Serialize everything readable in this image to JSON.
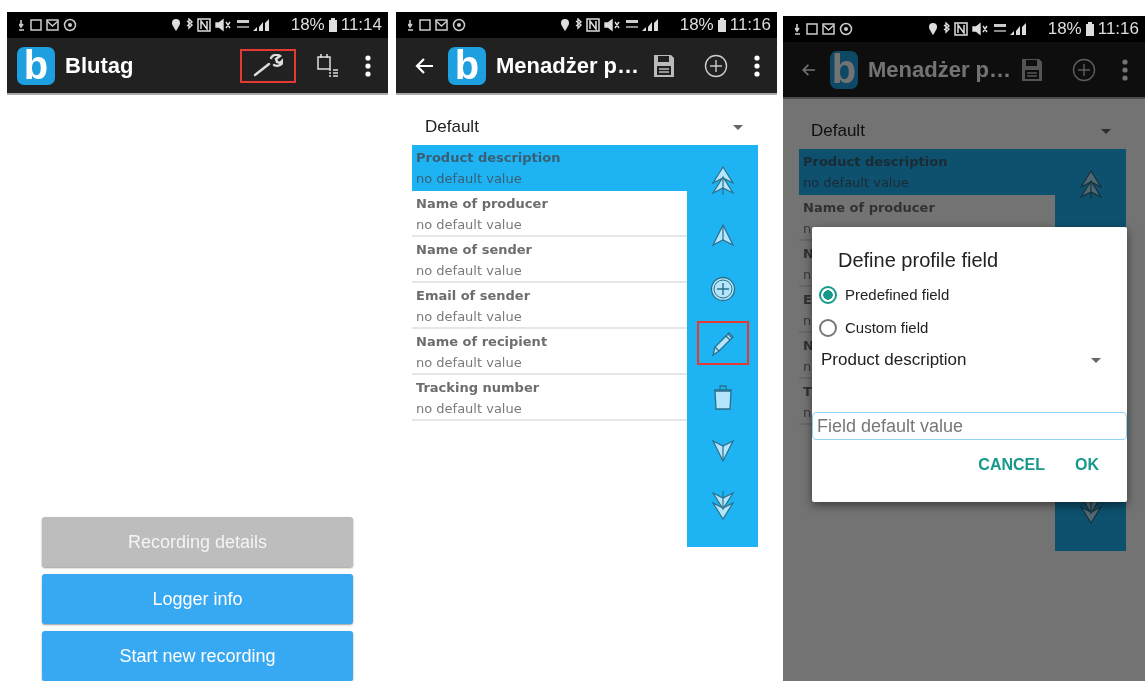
{
  "screens": [
    {
      "kind": "home",
      "status_bar": {
        "battery": "18%",
        "time": "11:14"
      },
      "app_bar": {
        "back": false,
        "logo_letter": "b",
        "title": "Blutag",
        "actions": [
          {
            "kind": "wrench",
            "highlighted": true
          },
          {
            "kind": "calendar",
            "highlighted": false
          },
          {
            "kind": "overflow",
            "highlighted": false
          }
        ]
      },
      "buttons": [
        {
          "label": "Recording details",
          "disabled": true
        },
        {
          "label": "Logger info",
          "disabled": false
        },
        {
          "label": "Start new recording",
          "disabled": false
        }
      ]
    },
    {
      "kind": "manager",
      "status_bar": {
        "battery": "18%",
        "time": "11:16"
      },
      "app_bar": {
        "back": true,
        "logo_letter": "b",
        "title": "Menadżer p…",
        "actions": [
          {
            "kind": "save",
            "highlighted": false
          },
          {
            "kind": "add",
            "highlighted": false
          },
          {
            "kind": "overflow",
            "highlighted": false
          }
        ]
      },
      "profile_select": {
        "value": "Default"
      },
      "fields": [
        {
          "name": "Product description",
          "value": "no default value",
          "selected": true
        },
        {
          "name": "Name of producer",
          "value": "no default value",
          "selected": false
        },
        {
          "name": "Name of sender",
          "value": "no default value",
          "selected": false
        },
        {
          "name": "Email of sender",
          "value": "no default value",
          "selected": false
        },
        {
          "name": "Name of recipient",
          "value": "no default value",
          "selected": false
        },
        {
          "name": "Tracking number",
          "value": "no default value",
          "selected": false
        }
      ],
      "tools": [
        {
          "kind": "top",
          "highlighted": false
        },
        {
          "kind": "up",
          "highlighted": false
        },
        {
          "kind": "add",
          "highlighted": false
        },
        {
          "kind": "edit",
          "highlighted": true
        },
        {
          "kind": "delete",
          "highlighted": false
        },
        {
          "kind": "down",
          "highlighted": false
        },
        {
          "kind": "bottom",
          "highlighted": false
        }
      ]
    },
    {
      "kind": "manager",
      "status_bar": {
        "battery": "18%",
        "time": "11:16"
      },
      "app_bar": {
        "back": true,
        "logo_letter": "b",
        "title": "Menadżer p…",
        "actions": [
          {
            "kind": "save",
            "highlighted": false
          },
          {
            "kind": "add",
            "highlighted": false
          },
          {
            "kind": "overflow",
            "highlighted": false
          }
        ]
      },
      "profile_select": {
        "value": "Default"
      },
      "fields": [
        {
          "name": "Product description",
          "value": "no default value",
          "selected": true
        },
        {
          "name": "Name of producer",
          "value": "n",
          "selected": false
        },
        {
          "name": "N",
          "value": "n",
          "selected": false
        },
        {
          "name": "E",
          "value": "n",
          "selected": false
        },
        {
          "name": "N",
          "value": "n",
          "selected": false
        },
        {
          "name": "T",
          "value": "n",
          "selected": false
        }
      ],
      "tools": [
        {
          "kind": "top",
          "highlighted": false
        },
        {
          "kind": "bottom",
          "highlighted": false
        }
      ],
      "dialog": {
        "title": "Define profile field",
        "options": [
          {
            "label": "Predefined field",
            "selected": true
          },
          {
            "label": "Custom field",
            "selected": false
          }
        ],
        "field_select": {
          "value": "Product description"
        },
        "input": {
          "placeholder": "Field default value"
        },
        "buttons": [
          "CANCEL",
          "OK"
        ]
      }
    }
  ]
}
